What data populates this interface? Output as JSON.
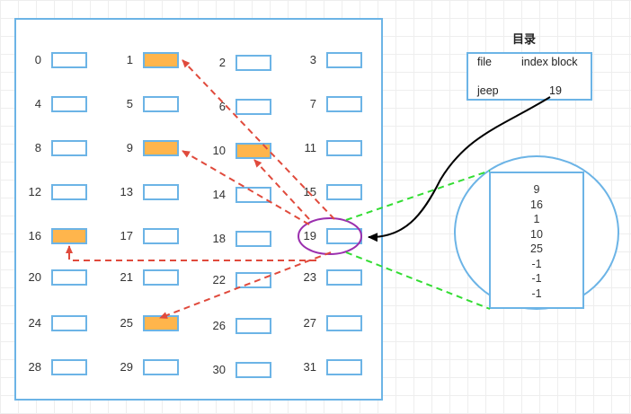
{
  "disk": {
    "blocks": [
      {
        "n": "0",
        "used": false
      },
      {
        "n": "1",
        "used": true
      },
      {
        "n": "2",
        "used": false
      },
      {
        "n": "3",
        "used": false
      },
      {
        "n": "4",
        "used": false
      },
      {
        "n": "5",
        "used": false
      },
      {
        "n": "6",
        "used": false
      },
      {
        "n": "7",
        "used": false
      },
      {
        "n": "8",
        "used": false
      },
      {
        "n": "9",
        "used": true
      },
      {
        "n": "10",
        "used": true
      },
      {
        "n": "11",
        "used": false
      },
      {
        "n": "12",
        "used": false
      },
      {
        "n": "13",
        "used": false
      },
      {
        "n": "14",
        "used": false
      },
      {
        "n": "15",
        "used": false
      },
      {
        "n": "16",
        "used": true
      },
      {
        "n": "17",
        "used": false
      },
      {
        "n": "18",
        "used": false
      },
      {
        "n": "19",
        "used": false
      },
      {
        "n": "20",
        "used": false
      },
      {
        "n": "21",
        "used": false
      },
      {
        "n": "22",
        "used": false
      },
      {
        "n": "23",
        "used": false
      },
      {
        "n": "24",
        "used": false
      },
      {
        "n": "25",
        "used": true
      },
      {
        "n": "26",
        "used": false
      },
      {
        "n": "27",
        "used": false
      },
      {
        "n": "28",
        "used": false
      },
      {
        "n": "29",
        "used": false
      },
      {
        "n": "30",
        "used": false
      },
      {
        "n": "31",
        "used": false
      }
    ],
    "index_block": 19,
    "pointed_blocks": [
      9,
      16,
      1,
      10,
      25
    ]
  },
  "directory": {
    "title": "目录",
    "header_file": "file",
    "header_index": "index block",
    "row_file": "jeep",
    "row_index": "19"
  },
  "index_block": {
    "entries": [
      "9",
      "16",
      "1",
      "10",
      "25",
      "-1",
      "-1",
      "-1"
    ]
  },
  "colors": {
    "border": "#6cb4e6",
    "used_fill": "#ffb54c",
    "pointer_arrow": "#e04a3c",
    "highlight_ellipse": "#9b2fae",
    "zoom_line": "#33dd33",
    "dir_arrow": "#000000"
  }
}
